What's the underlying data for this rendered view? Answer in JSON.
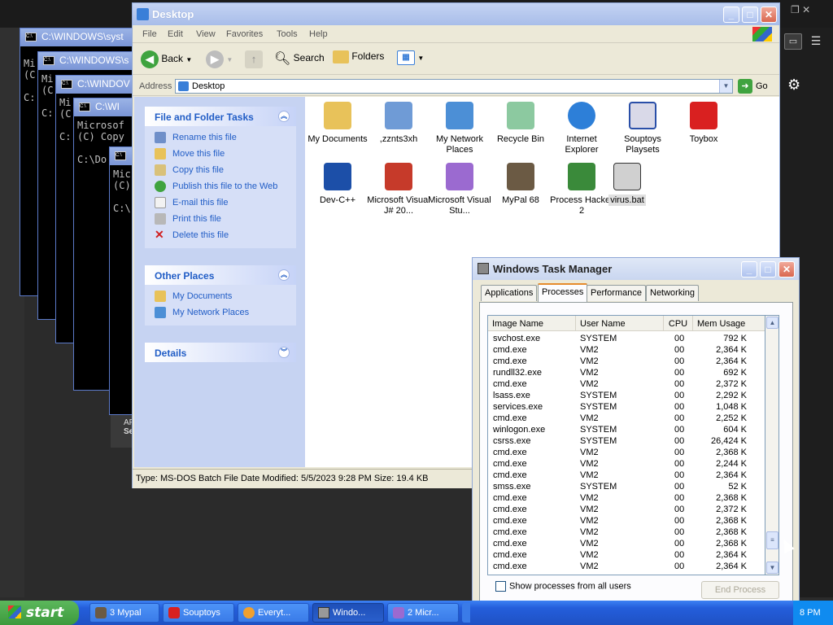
{
  "background": {
    "cmd_windows": [
      {
        "title": "C:\\WINDOWS\\syst",
        "lines": [
          "Mi",
          "(C",
          "",
          "C:"
        ]
      },
      {
        "title": "C:\\WINDOWS\\s",
        "lines": [
          "Mi",
          "(C",
          "",
          "C:"
        ]
      },
      {
        "title": "C:\\WINDOV",
        "lines": [
          "Mi",
          "(C",
          "",
          "C:"
        ]
      },
      {
        "title": "C:\\WI",
        "lines": [
          "Microsof",
          "(C) Copy",
          "",
          "C:\\Do"
        ]
      },
      {
        "title": "",
        "lines": [
          "Mic",
          "(C)",
          "",
          "C:\\"
        ]
      }
    ],
    "fragments": [
      "AF",
      "Se",
      "8 PM"
    ]
  },
  "explorer": {
    "title": "Desktop",
    "menu": [
      "File",
      "Edit",
      "View",
      "Favorites",
      "Tools",
      "Help"
    ],
    "toolbar": {
      "back": "Back",
      "search": "Search",
      "folders": "Folders"
    },
    "address": {
      "label": "Address",
      "value": "Desktop",
      "go": "Go"
    },
    "tasks_panel": {
      "title": "File and Folder Tasks",
      "items": [
        "Rename this file",
        "Move this file",
        "Copy this file",
        "Publish this file to the Web",
        "E-mail this file",
        "Print this file",
        "Delete this file"
      ]
    },
    "places_panel": {
      "title": "Other Places",
      "items": [
        "My Documents",
        "My Network Places"
      ]
    },
    "details_panel": {
      "title": "Details"
    },
    "icons": [
      {
        "label": "My Documents",
        "icon": "documents-folder-icon",
        "color": "#e8c25a"
      },
      {
        "label": ",zznts3xh",
        "icon": "computer-icon",
        "color": "#6f9bd6"
      },
      {
        "label": "My Network Places",
        "icon": "network-icon",
        "color": "#4c8fd6"
      },
      {
        "label": "Recycle Bin",
        "icon": "recycle-bin-icon",
        "color": "#8cc9a0"
      },
      {
        "label": "Internet Explorer",
        "icon": "internet-explorer-icon",
        "color": "#2d7fd8"
      },
      {
        "label": "Souptoys Playsets",
        "icon": "window-icon",
        "color": "#d9d9e8"
      },
      {
        "label": "Toybox",
        "icon": "toybox-icon",
        "color": "#d92020"
      },
      {
        "label": "Dev-C++",
        "icon": "devcpp-icon",
        "color": "#1c4fa8"
      },
      {
        "label": "Microsoft Visual J# 20...",
        "icon": "visual-j-icon",
        "color": "#c63a2a"
      },
      {
        "label": "Microsoft Visual Stu...",
        "icon": "visual-studio-icon",
        "color": "#9b6ad0"
      },
      {
        "label": "MyPal 68",
        "icon": "mypal-icon",
        "color": "#6b5a44"
      },
      {
        "label": "Process Hacker 2",
        "icon": "process-hacker-icon",
        "color": "#3a8a3a"
      },
      {
        "label": "virus.bat",
        "icon": "batch-file-icon",
        "color": "#d0d0d0"
      }
    ],
    "status": "Type: MS-DOS Batch File Date Modified: 5/5/2023 9:28 PM Size: 19.4 KB"
  },
  "task_manager": {
    "title": "Windows Task Manager",
    "tabs": [
      "Applications",
      "Processes",
      "Performance",
      "Networking"
    ],
    "active_tab": "Processes",
    "columns": [
      "Image Name",
      "User Name",
      "CPU",
      "Mem Usage"
    ],
    "rows": [
      [
        "svchost.exe",
        "SYSTEM",
        "00",
        "792 K"
      ],
      [
        "cmd.exe",
        "VM2",
        "00",
        "2,364 K"
      ],
      [
        "cmd.exe",
        "VM2",
        "00",
        "2,364 K"
      ],
      [
        "rundll32.exe",
        "VM2",
        "00",
        "692 K"
      ],
      [
        "cmd.exe",
        "VM2",
        "00",
        "2,372 K"
      ],
      [
        "lsass.exe",
        "SYSTEM",
        "00",
        "2,292 K"
      ],
      [
        "services.exe",
        "SYSTEM",
        "00",
        "1,048 K"
      ],
      [
        "cmd.exe",
        "VM2",
        "00",
        "2,252 K"
      ],
      [
        "winlogon.exe",
        "SYSTEM",
        "00",
        "604 K"
      ],
      [
        "csrss.exe",
        "SYSTEM",
        "00",
        "26,424 K"
      ],
      [
        "cmd.exe",
        "VM2",
        "00",
        "2,368 K"
      ],
      [
        "cmd.exe",
        "VM2",
        "00",
        "2,244 K"
      ],
      [
        "cmd.exe",
        "VM2",
        "00",
        "2,364 K"
      ],
      [
        "smss.exe",
        "SYSTEM",
        "00",
        "52 K"
      ],
      [
        "cmd.exe",
        "VM2",
        "00",
        "2,368 K"
      ],
      [
        "cmd.exe",
        "VM2",
        "00",
        "2,372 K"
      ],
      [
        "cmd.exe",
        "VM2",
        "00",
        "2,368 K"
      ],
      [
        "cmd.exe",
        "VM2",
        "00",
        "2,368 K"
      ],
      [
        "cmd.exe",
        "VM2",
        "00",
        "2,368 K"
      ],
      [
        "cmd.exe",
        "VM2",
        "00",
        "2,364 K"
      ],
      [
        "cmd.exe",
        "VM2",
        "00",
        "2,364 K"
      ]
    ],
    "show_all_label": "Show processes from all users",
    "end_process": "End Process"
  },
  "taskbar": {
    "start": "start",
    "tasks": [
      {
        "label": "3 Mypal",
        "count_color": "#ff6060"
      },
      {
        "label": "Souptoys"
      },
      {
        "label": "Everyt..."
      },
      {
        "label": "Windo..."
      },
      {
        "label": "2 Micr..."
      }
    ]
  },
  "colors": {
    "xp_blue": "#245edb",
    "link_blue": "#215dc6",
    "start_green": "#3c9a3c"
  }
}
